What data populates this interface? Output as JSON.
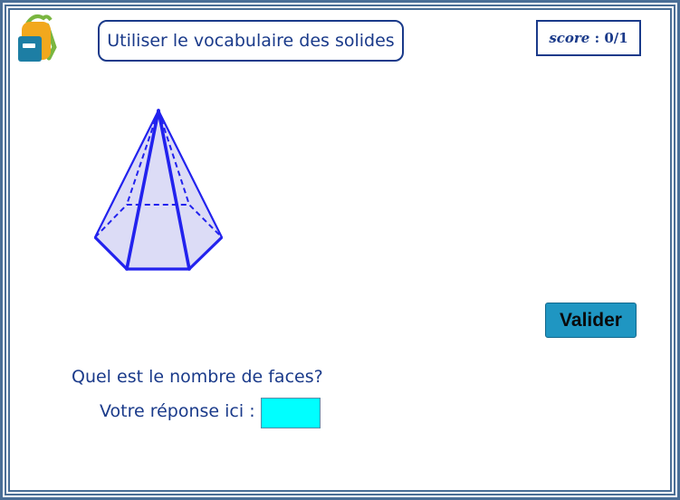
{
  "header": {
    "title": "Utiliser le vocabulaire des solides",
    "score_label": "score",
    "score_separator": " : ",
    "score_value": "0/1",
    "logo_icon": "backpack-icon"
  },
  "figure": {
    "icon": "hexagonal-pyramid-icon",
    "edge_color": "#2222ee",
    "face_color": "#dcdcf6"
  },
  "actions": {
    "validate_label": "Valider"
  },
  "exercise": {
    "question": "Quel est le nombre de faces?",
    "answer_label": "Votre réponse ici :",
    "answer_value": "",
    "answer_placeholder": ""
  },
  "colors": {
    "frame": "#4a6e96",
    "text": "#1a3a8a",
    "button": "#1f96c2",
    "input": "#00ffff"
  }
}
